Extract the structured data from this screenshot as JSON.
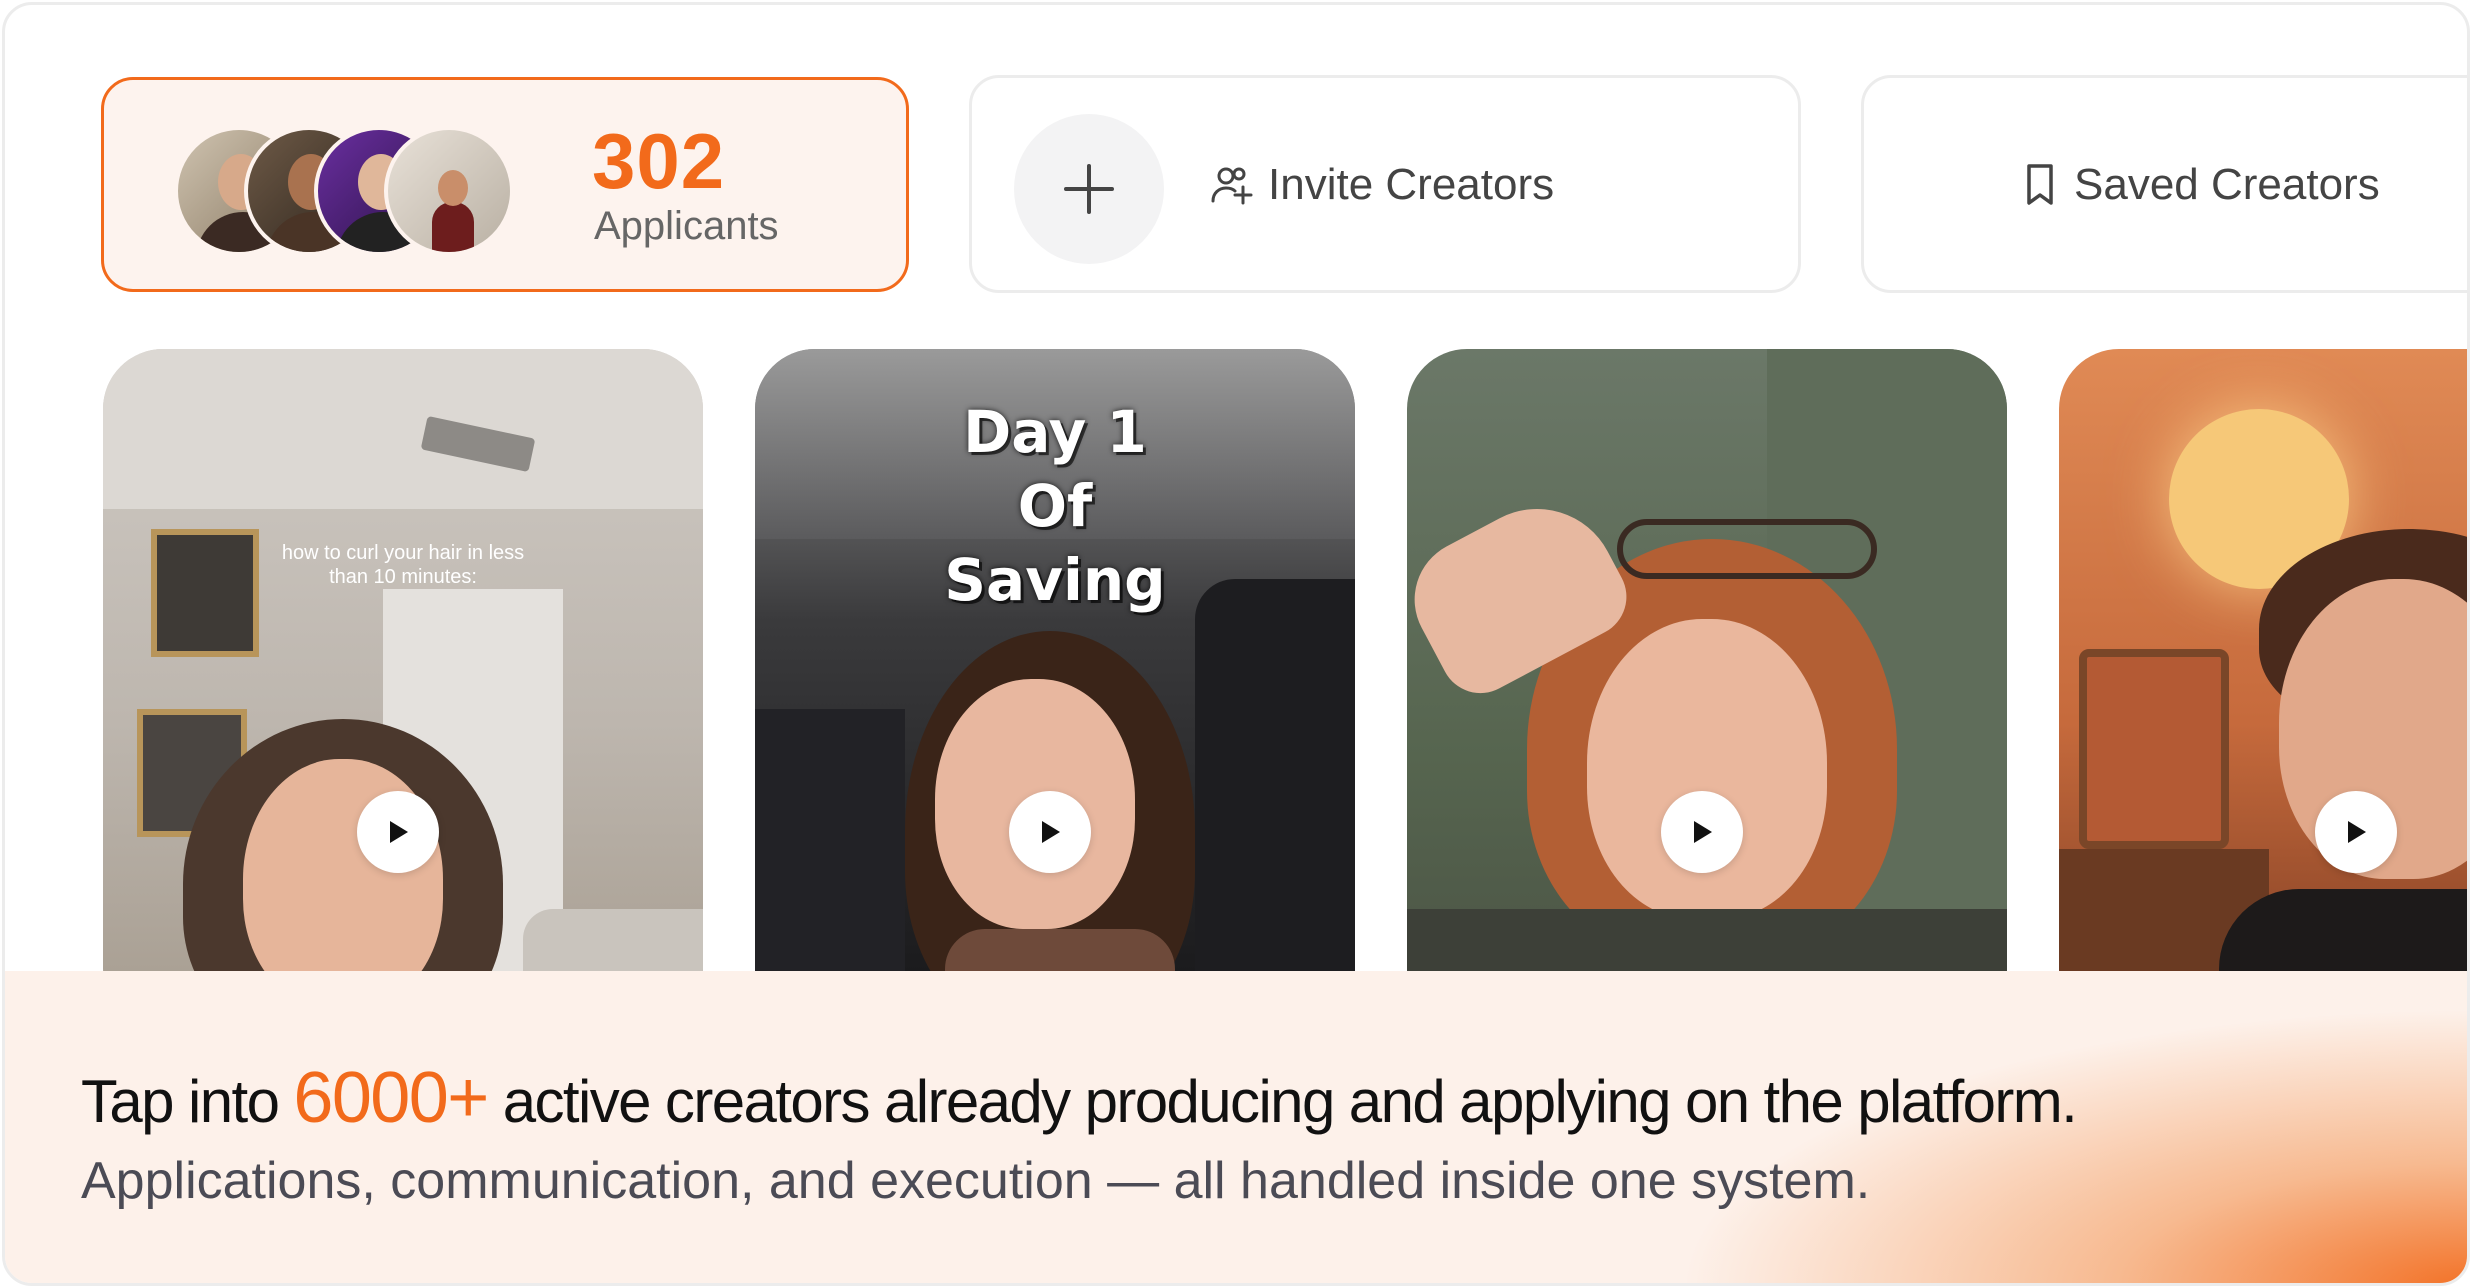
{
  "applicants": {
    "count": "302",
    "label": "Applicants",
    "avatars": [
      "avatar-1",
      "avatar-2",
      "avatar-3",
      "avatar-4"
    ]
  },
  "actions": {
    "add_icon": "plus-icon",
    "invite_icon": "users-plus-icon",
    "invite_label": "Invite Creators",
    "saved_icon": "bookmark-icon",
    "saved_label": "Saved Creators"
  },
  "videos": [
    {
      "overlay_text": "how to curl your hair in less than 10 minutes:",
      "play_icon": "play-icon"
    },
    {
      "overlay_text": "Day 1 Of Saving",
      "play_icon": "play-icon"
    },
    {
      "overlay_text": "",
      "play_icon": "play-icon"
    },
    {
      "overlay_text": "",
      "play_icon": "play-icon"
    }
  ],
  "caption": {
    "headline_prefix": "Tap into ",
    "headline_highlight": "6000+",
    "headline_suffix": " active creators already producing and applying on the platform.",
    "subline": "Applications, communication, and execution — all handled inside one system."
  },
  "colors": {
    "accent": "#f26a1b",
    "card_border": "#ececec",
    "applicants_bg": "#fdf3ee",
    "caption_bg": "#fdf1ea"
  }
}
